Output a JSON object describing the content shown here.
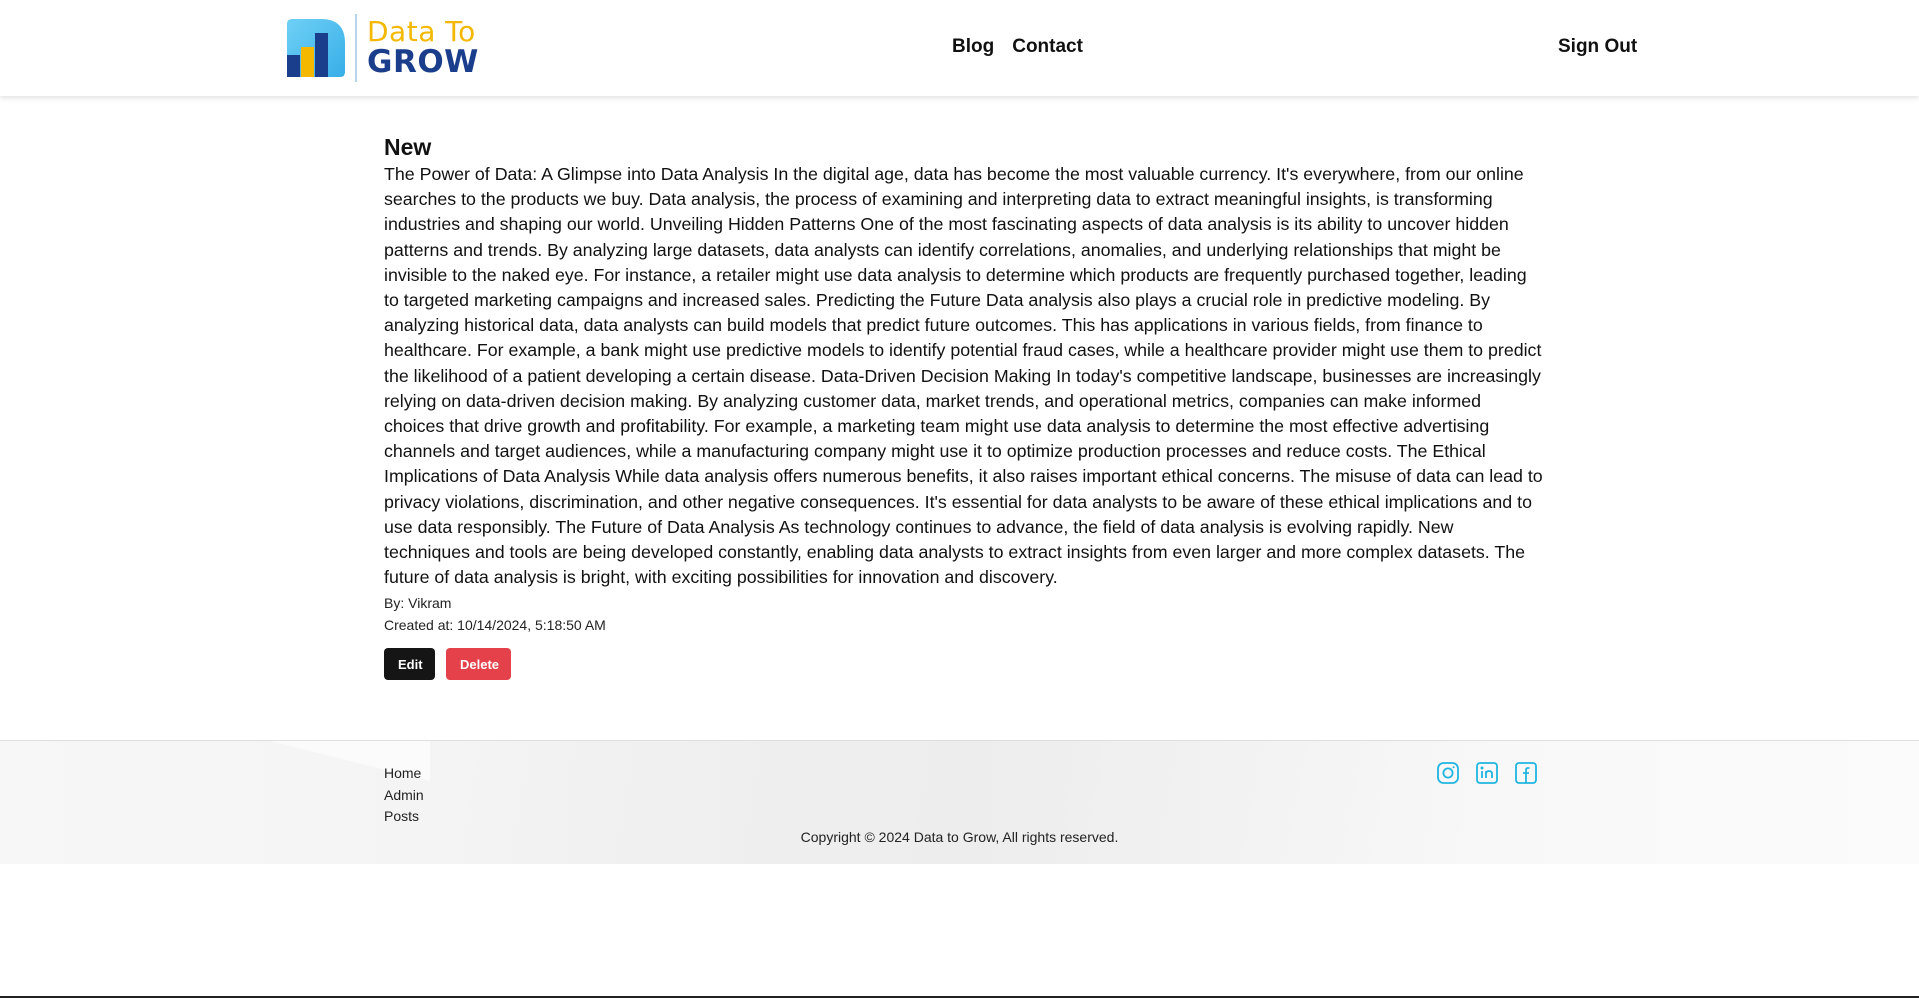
{
  "brand": {
    "line1": "Data To",
    "line2": "GROW"
  },
  "nav": {
    "blog": "Blog",
    "contact": "Contact",
    "sign_out": "Sign Out"
  },
  "post": {
    "title": "New",
    "body": "The Power of Data: A Glimpse into Data Analysis In the digital age, data has become the most valuable currency. It's everywhere, from our online searches to the products we buy. Data analysis, the process of examining and interpreting data to extract meaningful insights, is transforming industries and shaping our world. Unveiling Hidden Patterns One of the most fascinating aspects of data analysis is its ability to uncover hidden patterns and trends. By analyzing large datasets, data analysts can identify correlations, anomalies, and underlying relationships that might be invisible to the naked eye. For instance, a retailer might use data analysis to determine which products are frequently purchased together, leading to targeted marketing campaigns and increased sales. Predicting the Future Data analysis also plays a crucial role in predictive modeling. By analyzing historical data, data analysts can build models that predict future outcomes. This has applications in various fields, from finance to healthcare. For example, a bank might use predictive models to identify potential fraud cases, while a healthcare provider might use them to predict the likelihood of a patient developing a certain disease. Data-Driven Decision Making In today's competitive landscape, businesses are increasingly relying on data-driven decision making. By analyzing customer data, market trends, and operational metrics, companies can make informed choices that drive growth and profitability. For example, a marketing team might use data analysis to determine the most effective advertising channels and target audiences, while a manufacturing company might use it to optimize production processes and reduce costs. The Ethical Implications of Data Analysis While data analysis offers numerous benefits, it also raises important ethical concerns. The misuse of data can lead to privacy violations, discrimination, and other negative consequences. It's essential for data analysts to be aware of these ethical implications and to use data responsibly. The Future of Data Analysis As technology continues to advance, the field of data analysis is evolving rapidly. New techniques and tools are being developed constantly, enabling data analysts to extract insights from even larger and more complex datasets. The future of data analysis is bright, with exciting possibilities for innovation and discovery.",
    "author": "By: Vikram",
    "created": "Created at: 10/14/2024, 5:18:50 AM",
    "edit_label": "Edit",
    "delete_label": "Delete"
  },
  "footer": {
    "links": [
      "Home",
      "Admin",
      "Posts"
    ],
    "socials": [
      "instagram-icon",
      "linkedin-icon",
      "facebook-icon"
    ],
    "copyright": "Copyright © 2024 Data to Grow, All rights reserved."
  },
  "colors": {
    "brand_yellow": "#f5b800",
    "brand_blue": "#1a3e8c",
    "delete_red": "#e5414a",
    "social_cyan": "#1fb5e0"
  }
}
